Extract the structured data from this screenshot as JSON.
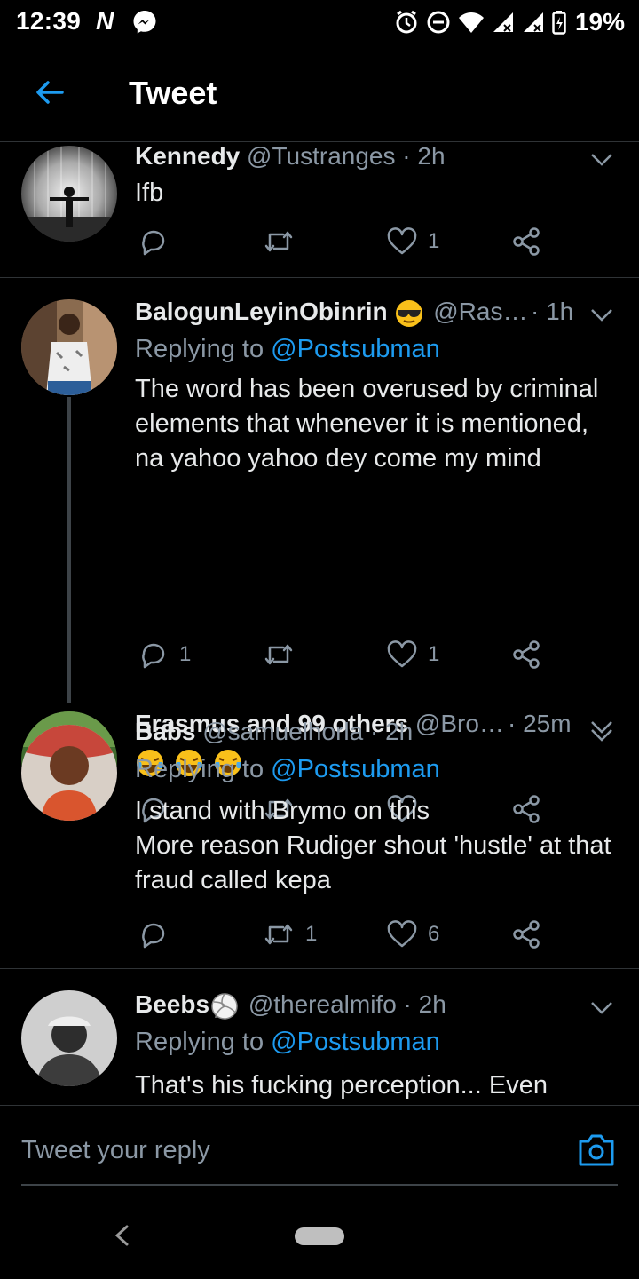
{
  "status_bar": {
    "time": "12:39",
    "network_letter": "N",
    "battery": "19%"
  },
  "header": {
    "title": "Tweet",
    "back_icon": "arrow-left-icon"
  },
  "tweets": [
    {
      "name": "Kennedy",
      "handle": "@Tustranges",
      "time": "· 2h",
      "replying_prefix": "",
      "replying_to": "",
      "text": "Ifb",
      "replies": "",
      "retweets": "",
      "likes": "1"
    },
    {
      "name": "BalogunLeyinObinrin",
      "handle": "@Ras…",
      "time": "· 1h",
      "replying_prefix": "Replying to",
      "replying_to": "@Postsubman",
      "text": "The word has been overused by criminal elements that whenever it is mentioned, na yahoo yahoo dey come my mind",
      "replies": "1",
      "retweets": "",
      "likes": "1"
    },
    {
      "name": "Erasmus and 99 others",
      "handle": "@Bro…",
      "time": "· 25m",
      "replying_prefix": "",
      "replying_to": "",
      "text": "",
      "replies": "",
      "retweets": "",
      "likes": ""
    },
    {
      "name": "Babs",
      "handle": "@samuelhorla",
      "time": "· 2h",
      "replying_prefix": "Replying to",
      "replying_to": "@Postsubman",
      "text_line1": "I stand with Brymo on this",
      "text_line2": "More reason Rudiger shout 'hustle' at that fraud called kepa",
      "replies": "",
      "retweets": "1",
      "likes": "6"
    },
    {
      "name": "Beebs",
      "handle": "@therealmifo",
      "time": "· 2h",
      "replying_prefix": "Replying to",
      "replying_to": "@Postsubman",
      "text": "That's his fucking perception... Even"
    }
  ],
  "compose": {
    "placeholder": "Tweet your reply"
  },
  "colors": {
    "background": "#000000",
    "accent": "#1d9bf0",
    "secondary_text": "#8b98a5",
    "divider": "#2f3336"
  }
}
